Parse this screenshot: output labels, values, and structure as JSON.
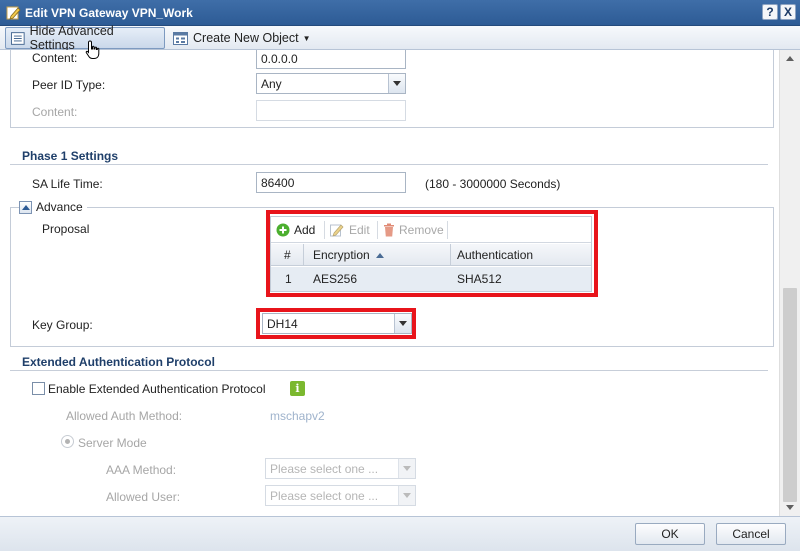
{
  "window": {
    "title": "Edit VPN Gateway VPN_Work",
    "help_label": "?",
    "close_label": "X"
  },
  "toolbar": {
    "hide_advanced_label": "Hide Advanced Settings",
    "create_object_label": "Create New Object"
  },
  "peer": {
    "content_label": "Content:",
    "content_value": "0.0.0.0",
    "peer_id_type_label": "Peer ID Type:",
    "peer_id_type_value": "Any",
    "content2_label": "Content:",
    "content2_value": ""
  },
  "phase1": {
    "title": "Phase 1 Settings",
    "sa_life_label": "SA Life Time:",
    "sa_life_value": "86400",
    "sa_life_hint": "(180 - 3000000 Seconds)",
    "advance_label": "Advance",
    "proposal_label": "Proposal",
    "grid": {
      "add_label": "Add",
      "edit_label": "Edit",
      "remove_label": "Remove",
      "columns": [
        "#",
        "Encryption",
        "Authentication"
      ],
      "rows": [
        {
          "num": "1",
          "encryption": "AES256",
          "authentication": "SHA512"
        }
      ]
    },
    "key_group_label": "Key Group:",
    "key_group_value": "DH14"
  },
  "xauth": {
    "title": "Extended Authentication Protocol",
    "enable_label": "Enable Extended Authentication Protocol",
    "info_label": "i",
    "allowed_auth_label": "Allowed Auth Method:",
    "allowed_auth_value": "mschapv2",
    "server_mode_label": "Server Mode",
    "aaa_method_label": "AAA Method:",
    "aaa_method_placeholder": "Please select one ...",
    "allowed_user_label": "Allowed User:",
    "allowed_user_placeholder": "Please select one ..."
  },
  "footer": {
    "ok_label": "OK",
    "cancel_label": "Cancel"
  },
  "colors": {
    "titlebar": "#2d5b95",
    "highlight_red": "#e8141b",
    "section_title": "#1f3f6a",
    "info_green": "#7bb82f"
  }
}
